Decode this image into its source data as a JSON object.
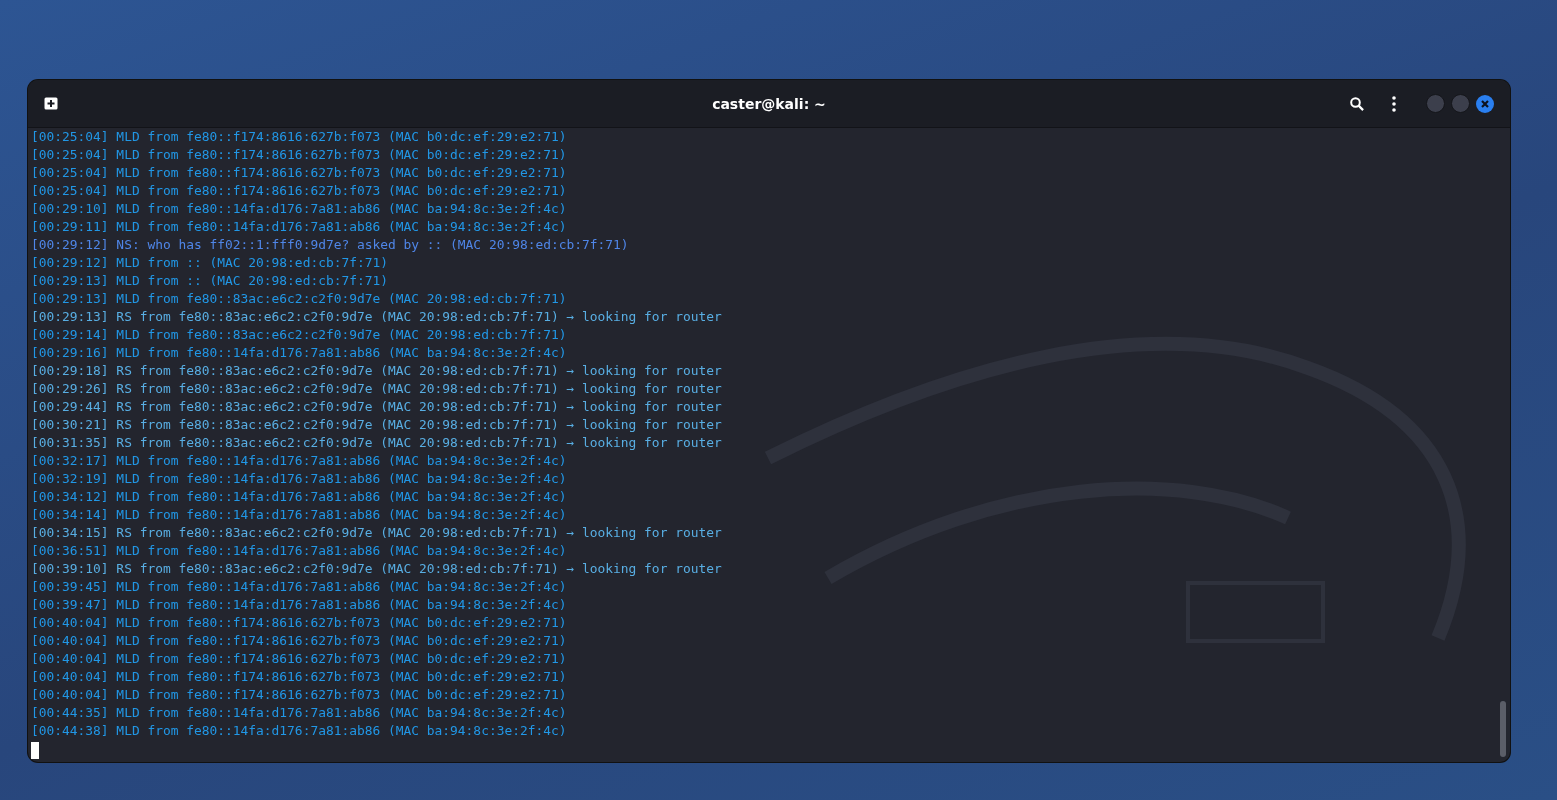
{
  "window": {
    "title": "caster@kali: ~"
  },
  "lines": [
    {
      "kind": "mld",
      "text": "[00:25:04] MLD from fe80::f174:8616:627b:f073 (MAC b0:dc:ef:29:e2:71)"
    },
    {
      "kind": "mld",
      "text": "[00:25:04] MLD from fe80::f174:8616:627b:f073 (MAC b0:dc:ef:29:e2:71)"
    },
    {
      "kind": "mld",
      "text": "[00:25:04] MLD from fe80::f174:8616:627b:f073 (MAC b0:dc:ef:29:e2:71)"
    },
    {
      "kind": "mld",
      "text": "[00:25:04] MLD from fe80::f174:8616:627b:f073 (MAC b0:dc:ef:29:e2:71)"
    },
    {
      "kind": "mld",
      "text": "[00:29:10] MLD from fe80::14fa:d176:7a81:ab86 (MAC ba:94:8c:3e:2f:4c)"
    },
    {
      "kind": "mld",
      "text": "[00:29:11] MLD from fe80::14fa:d176:7a81:ab86 (MAC ba:94:8c:3e:2f:4c)"
    },
    {
      "kind": "ns",
      "text": "[00:29:12] NS: who has ff02::1:fff0:9d7e? asked by :: (MAC 20:98:ed:cb:7f:71)"
    },
    {
      "kind": "mld",
      "text": "[00:29:12] MLD from :: (MAC 20:98:ed:cb:7f:71)"
    },
    {
      "kind": "mld",
      "text": "[00:29:13] MLD from :: (MAC 20:98:ed:cb:7f:71)"
    },
    {
      "kind": "mld",
      "text": "[00:29:13] MLD from fe80::83ac:e6c2:c2f0:9d7e (MAC 20:98:ed:cb:7f:71)"
    },
    {
      "kind": "rs",
      "text": "[00:29:13] RS from fe80::83ac:e6c2:c2f0:9d7e (MAC 20:98:ed:cb:7f:71) → looking for router"
    },
    {
      "kind": "mld",
      "text": "[00:29:14] MLD from fe80::83ac:e6c2:c2f0:9d7e (MAC 20:98:ed:cb:7f:71)"
    },
    {
      "kind": "mld",
      "text": "[00:29:16] MLD from fe80::14fa:d176:7a81:ab86 (MAC ba:94:8c:3e:2f:4c)"
    },
    {
      "kind": "rs",
      "text": "[00:29:18] RS from fe80::83ac:e6c2:c2f0:9d7e (MAC 20:98:ed:cb:7f:71) → looking for router"
    },
    {
      "kind": "rs",
      "text": "[00:29:26] RS from fe80::83ac:e6c2:c2f0:9d7e (MAC 20:98:ed:cb:7f:71) → looking for router"
    },
    {
      "kind": "rs",
      "text": "[00:29:44] RS from fe80::83ac:e6c2:c2f0:9d7e (MAC 20:98:ed:cb:7f:71) → looking for router"
    },
    {
      "kind": "rs",
      "text": "[00:30:21] RS from fe80::83ac:e6c2:c2f0:9d7e (MAC 20:98:ed:cb:7f:71) → looking for router"
    },
    {
      "kind": "rs",
      "text": "[00:31:35] RS from fe80::83ac:e6c2:c2f0:9d7e (MAC 20:98:ed:cb:7f:71) → looking for router"
    },
    {
      "kind": "mld",
      "text": "[00:32:17] MLD from fe80::14fa:d176:7a81:ab86 (MAC ba:94:8c:3e:2f:4c)"
    },
    {
      "kind": "mld",
      "text": "[00:32:19] MLD from fe80::14fa:d176:7a81:ab86 (MAC ba:94:8c:3e:2f:4c)"
    },
    {
      "kind": "mld",
      "text": "[00:34:12] MLD from fe80::14fa:d176:7a81:ab86 (MAC ba:94:8c:3e:2f:4c)"
    },
    {
      "kind": "mld",
      "text": "[00:34:14] MLD from fe80::14fa:d176:7a81:ab86 (MAC ba:94:8c:3e:2f:4c)"
    },
    {
      "kind": "rs",
      "text": "[00:34:15] RS from fe80::83ac:e6c2:c2f0:9d7e (MAC 20:98:ed:cb:7f:71) → looking for router"
    },
    {
      "kind": "mld",
      "text": "[00:36:51] MLD from fe80::14fa:d176:7a81:ab86 (MAC ba:94:8c:3e:2f:4c)"
    },
    {
      "kind": "rs",
      "text": "[00:39:10] RS from fe80::83ac:e6c2:c2f0:9d7e (MAC 20:98:ed:cb:7f:71) → looking for router"
    },
    {
      "kind": "mld",
      "text": "[00:39:45] MLD from fe80::14fa:d176:7a81:ab86 (MAC ba:94:8c:3e:2f:4c)"
    },
    {
      "kind": "mld",
      "text": "[00:39:47] MLD from fe80::14fa:d176:7a81:ab86 (MAC ba:94:8c:3e:2f:4c)"
    },
    {
      "kind": "mld",
      "text": "[00:40:04] MLD from fe80::f174:8616:627b:f073 (MAC b0:dc:ef:29:e2:71)"
    },
    {
      "kind": "mld",
      "text": "[00:40:04] MLD from fe80::f174:8616:627b:f073 (MAC b0:dc:ef:29:e2:71)"
    },
    {
      "kind": "mld",
      "text": "[00:40:04] MLD from fe80::f174:8616:627b:f073 (MAC b0:dc:ef:29:e2:71)"
    },
    {
      "kind": "mld",
      "text": "[00:40:04] MLD from fe80::f174:8616:627b:f073 (MAC b0:dc:ef:29:e2:71)"
    },
    {
      "kind": "mld",
      "text": "[00:40:04] MLD from fe80::f174:8616:627b:f073 (MAC b0:dc:ef:29:e2:71)"
    },
    {
      "kind": "mld",
      "text": "[00:44:35] MLD from fe80::14fa:d176:7a81:ab86 (MAC ba:94:8c:3e:2f:4c)"
    },
    {
      "kind": "mld",
      "text": "[00:44:38] MLD from fe80::14fa:d176:7a81:ab86 (MAC ba:94:8c:3e:2f:4c)"
    }
  ]
}
